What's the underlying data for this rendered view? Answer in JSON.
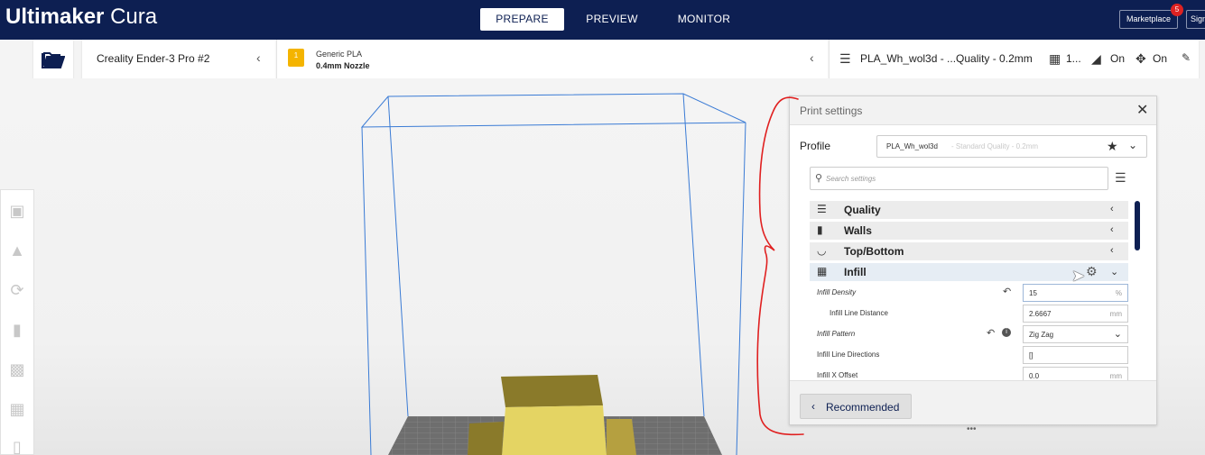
{
  "app": {
    "title_bold": "Ultimaker",
    "title_light": "Cura"
  },
  "stages": [
    {
      "label": "PREPARE",
      "active": true
    },
    {
      "label": "PREVIEW",
      "active": false
    },
    {
      "label": "MONITOR",
      "active": false
    }
  ],
  "marketplace": {
    "label": "Marketplace",
    "badge": "5"
  },
  "sign_in": {
    "label": "Sign in"
  },
  "printer": {
    "name": "Creality Ender-3 Pro #2"
  },
  "material": {
    "slot": "1",
    "name": "Generic PLA",
    "nozzle": "0.4mm Nozzle"
  },
  "print_summary": {
    "profile": "PLA_Wh_wol3d - ...Quality - 0.2mm",
    "infill": "1...",
    "support": "On",
    "adhesion": "On"
  },
  "panel": {
    "title": "Print settings",
    "profile_label": "Profile",
    "profile_name": "PLA_Wh_wol3d",
    "profile_quality": "- Standard Quality - 0.2mm",
    "search_placeholder": "Search settings",
    "categories": [
      {
        "label": "Quality",
        "icon": "quality-icon"
      },
      {
        "label": "Walls",
        "icon": "walls-icon"
      },
      {
        "label": "Top/Bottom",
        "icon": "top-bottom-icon"
      },
      {
        "label": "Infill",
        "icon": "infill-icon",
        "expanded": true
      }
    ],
    "settings": [
      {
        "label": "Infill Density",
        "value": "15",
        "unit": "%"
      },
      {
        "label": "Infill Line Distance",
        "value": "2.6667",
        "unit": "mm"
      },
      {
        "label": "Infill Pattern",
        "value": "Zig Zag"
      },
      {
        "label": "Infill Line Directions",
        "value": "[]"
      },
      {
        "label": "Infill X Offset",
        "value": "0.0",
        "unit": "mm"
      }
    ],
    "recommended_label": "Recommended"
  },
  "colors": {
    "header": "#0d1f52",
    "build_volume": "#3a7bd5",
    "model": "#d9c65a",
    "annotation": "#e02020"
  }
}
